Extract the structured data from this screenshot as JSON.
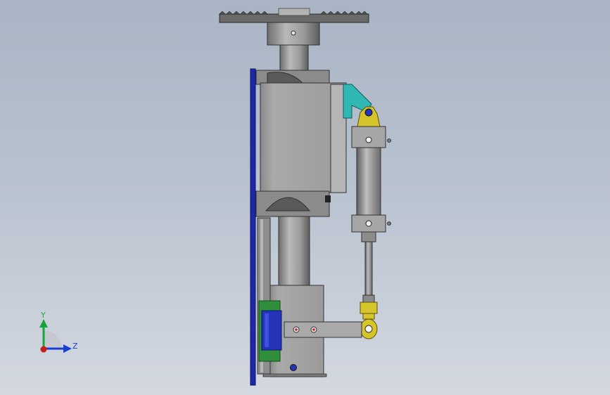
{
  "viewport": {
    "background_top": "#a9b4c4",
    "background_bottom": "#d3d8e0"
  },
  "triad": {
    "x_label": "Z",
    "y_label": "Y",
    "colors": {
      "y": "#1aa53a",
      "z": "#1a3fd0",
      "origin": "#c81e1e"
    }
  },
  "model": {
    "colors": {
      "steel": "#a3a3a3",
      "steel_dark": "#6f6f6f",
      "plate": "#1d27a8",
      "bracket": "#2fb7b3",
      "clevis": "#d6c42b",
      "bearing_frame": "#2f8f3a",
      "bearing_core": "#2433b8"
    },
    "icons": [
      "sprocket-icon",
      "gearbox-icon",
      "air-cylinder-icon",
      "linear-bearing-icon",
      "mounting-plate-icon"
    ]
  }
}
